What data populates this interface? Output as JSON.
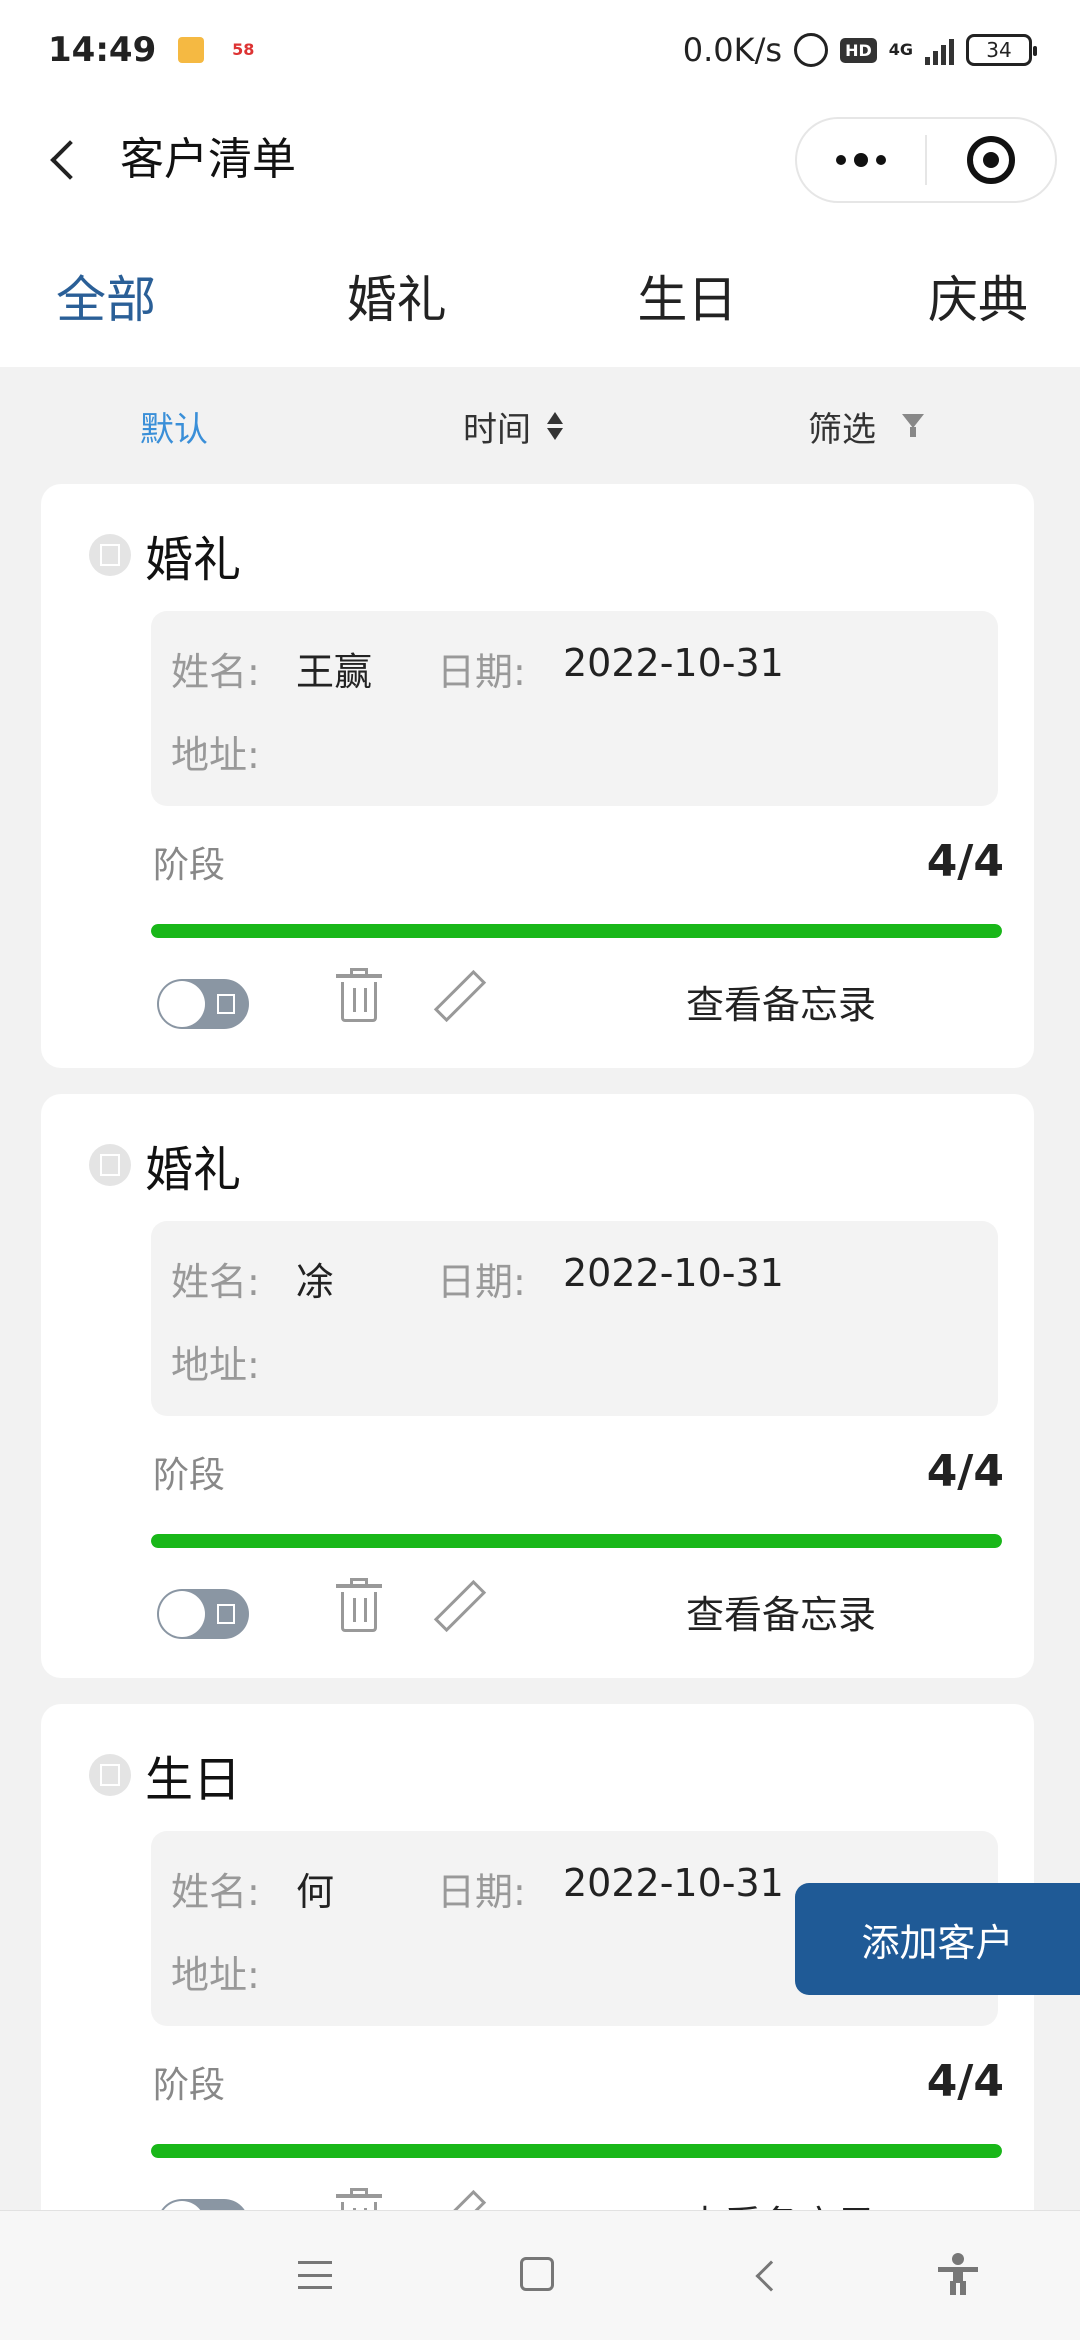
{
  "status_bar": {
    "time": "14:49",
    "app_badge": "58",
    "net_speed": "0.0K/s",
    "hd": "HD",
    "network": "4G",
    "battery": "34"
  },
  "nav": {
    "title": "客户清单"
  },
  "tabs": [
    {
      "label": "全部",
      "active": true
    },
    {
      "label": "婚礼",
      "active": false
    },
    {
      "label": "生日",
      "active": false
    },
    {
      "label": "庆典",
      "active": false
    }
  ],
  "sort": {
    "default_label": "默认",
    "time_label": "时间",
    "filter_label": "筛选"
  },
  "labels": {
    "name": "姓名:",
    "date": "日期:",
    "address": "地址:",
    "stage": "阶段",
    "memo": "查看备忘录"
  },
  "cards": [
    {
      "type": "婚礼",
      "name": "王赢",
      "date": "2022-10-31",
      "address": "",
      "stage": "4/4",
      "progress": 1.0
    },
    {
      "type": "婚礼",
      "name": "凃",
      "date": "2022-10-31",
      "address": "",
      "stage": "4/4",
      "progress": 1.0
    },
    {
      "type": "生日",
      "name": "何",
      "date": "2022-10-31",
      "address": "",
      "stage": "4/4",
      "progress": 1.0
    }
  ],
  "add_button": "添加客户",
  "colors": {
    "accent": "#1f5a96",
    "active_tab": "#2a5f97",
    "sort_active": "#3a8fd8",
    "progress": "#19b719"
  }
}
